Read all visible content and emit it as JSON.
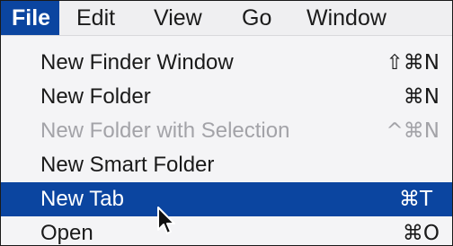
{
  "menubar": {
    "items": [
      {
        "label": "File"
      },
      {
        "label": "Edit"
      },
      {
        "label": "View"
      },
      {
        "label": "Go"
      },
      {
        "label": "Window"
      }
    ],
    "active_index": 0
  },
  "file_menu": {
    "items": [
      {
        "label": "New Finder Window",
        "shortcut": "⇧⌘N",
        "enabled": true
      },
      {
        "label": "New Folder",
        "shortcut": "⌘N",
        "enabled": true
      },
      {
        "label": "New Folder with Selection",
        "shortcut": "^⌘N",
        "enabled": false
      },
      {
        "label": "New Smart Folder",
        "shortcut": "",
        "enabled": true
      },
      {
        "label": "New Tab",
        "shortcut": "⌘T",
        "enabled": true,
        "highlighted": true
      },
      {
        "label": "Open",
        "shortcut": "⌘O",
        "enabled": true
      }
    ]
  },
  "colors": {
    "highlight": "#0b45a0",
    "menu_background": "#f4f4f6",
    "disabled_text": "#a3a3a8"
  },
  "pointer": {
    "icon": "arrow-cursor-icon"
  }
}
